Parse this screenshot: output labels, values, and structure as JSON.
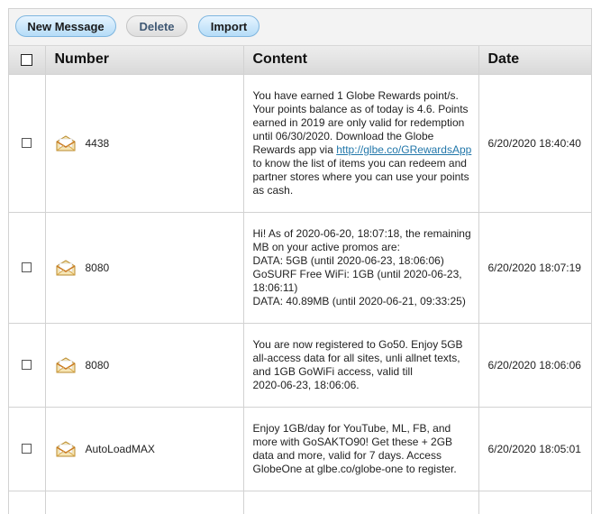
{
  "toolbar": {
    "new_message": "New Message",
    "delete": "Delete",
    "import": "Import"
  },
  "table": {
    "headers": {
      "number": "Number",
      "content": "Content",
      "date": "Date"
    },
    "rows": [
      {
        "number": "4438",
        "content_lines": [
          "You have earned 1 Globe Rewards point/s.",
          "Your points balance as of today is 4.6. Points",
          "earned in 2019 are only valid for redemption",
          "until 06/30/2020. Download the Globe",
          "Rewards app via ",
          "to know the list of items you can redeem and",
          "partner stores where you can use your points",
          "as cash."
        ],
        "link": "http://glbe.co/GRewardsApp",
        "date": "6/20/2020 18:40:40"
      },
      {
        "number": "8080",
        "content_lines": [
          "Hi! As of 2020-06-20, 18:07:18, the remaining",
          "MB on your active promos are:",
          "DATA: 5GB (until 2020-06-23, 18:06:06)",
          "GoSURF Free WiFi: 1GB (until 2020-06-23,",
          "18:06:11)",
          "DATA: 40.89MB (until 2020-06-21, 09:33:25)"
        ],
        "date": "6/20/2020 18:07:19"
      },
      {
        "number": "8080",
        "content_lines": [
          "You are now registered to Go50. Enjoy 5GB",
          "all-access data for all sites, unli allnet texts,",
          "and 1GB GoWiFi access, valid till",
          "2020-06-23, 18:06:06."
        ],
        "date": "6/20/2020 18:06:06"
      },
      {
        "number": "AutoLoadMAX",
        "content_lines": [
          "Enjoy 1GB/day for YouTube, ML, FB, and",
          "more with GoSAKTO90! Get these + 2GB",
          "data and more, valid for 7 days. Access",
          "GlobeOne at glbe.co/globe-one to register."
        ],
        "date": "6/20/2020 18:05:01"
      }
    ]
  }
}
